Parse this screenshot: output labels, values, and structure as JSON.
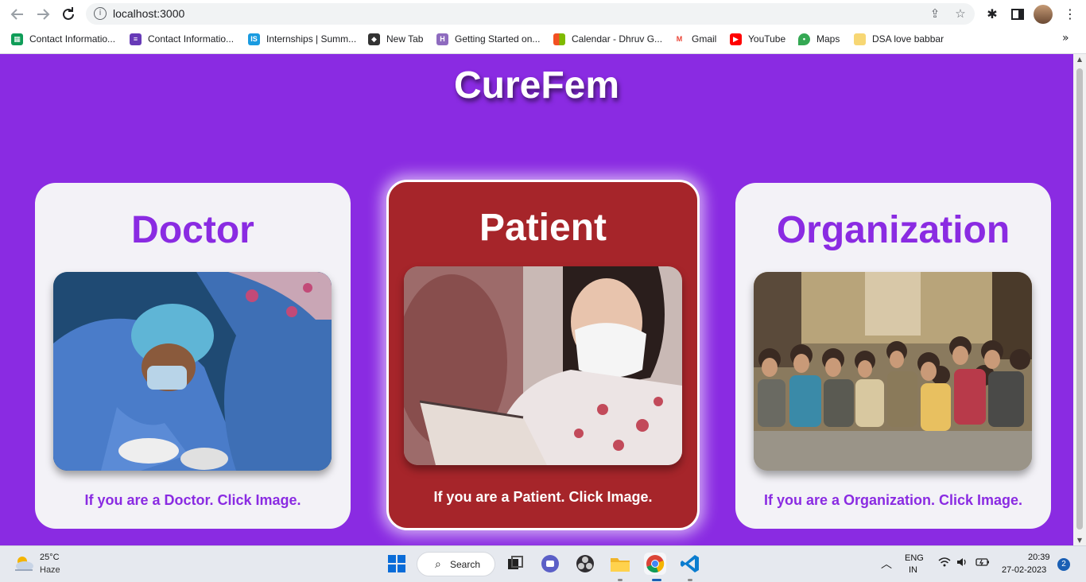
{
  "browser": {
    "url": "localhost:3000",
    "bookmarks": [
      {
        "label": "Contact Informatio...",
        "color": "#0f9d58"
      },
      {
        "label": "Contact Informatio...",
        "color": "#673ab7"
      },
      {
        "label": "Internships | Summ...",
        "color": "#1a9be0",
        "glyph": "IS"
      },
      {
        "label": "New Tab",
        "color": "#333333"
      },
      {
        "label": "Getting Started on...",
        "color": "#8e6bbf",
        "glyph": "H"
      },
      {
        "label": "Calendar - Dhruv G...",
        "color": "#f25022"
      },
      {
        "label": "Gmail",
        "color": "#ea4335",
        "glyph": "M"
      },
      {
        "label": "YouTube",
        "color": "#ff0000"
      },
      {
        "label": "Maps",
        "color": "#34a853"
      },
      {
        "label": "DSA love babbar",
        "color": "#f7d774"
      }
    ]
  },
  "page": {
    "title": "CureFem",
    "accent": "#8a2be2",
    "patient_bg": "#a6252a",
    "cards": {
      "doctor": {
        "title": "Doctor",
        "caption": "If you are a Doctor. Click Image."
      },
      "patient": {
        "title": "Patient",
        "caption": "If you are a Patient. Click Image."
      },
      "organization": {
        "title": "Organization",
        "caption": "If you are a Organization. Click Image."
      }
    }
  },
  "taskbar": {
    "weather_temp": "25°C",
    "weather_desc": "Haze",
    "search_label": "Search",
    "lang_line1": "ENG",
    "lang_line2": "IN",
    "time": "20:39",
    "date": "27-02-2023",
    "notification_count": "2"
  }
}
